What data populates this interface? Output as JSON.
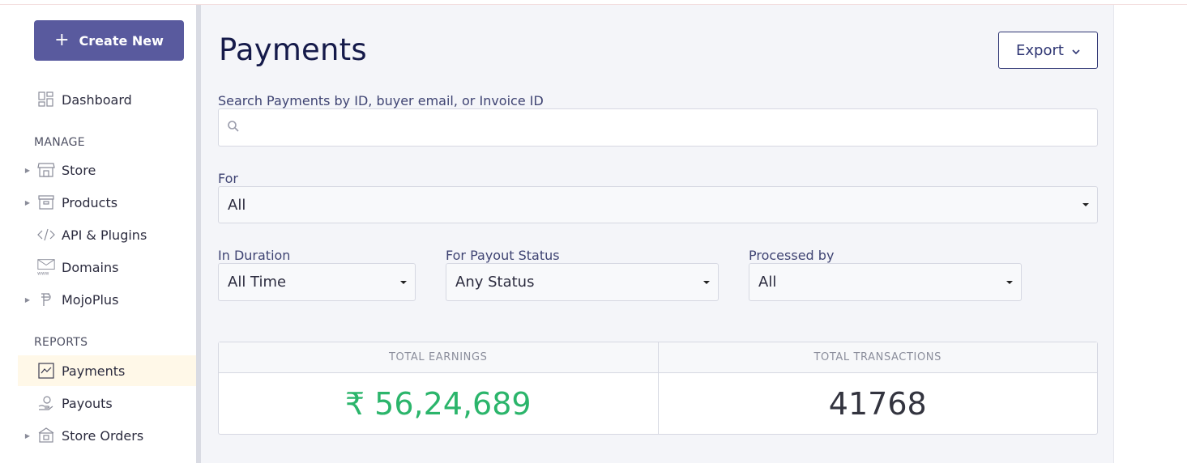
{
  "sidebar": {
    "create_label": "Create New",
    "dashboard": "Dashboard",
    "section_manage": "MANAGE",
    "manage_items": [
      {
        "label": "Store",
        "icon": "store-icon",
        "expandable": true
      },
      {
        "label": "Products",
        "icon": "products-icon",
        "expandable": true
      },
      {
        "label": "API & Plugins",
        "icon": "code-icon",
        "expandable": false
      },
      {
        "label": "Domains",
        "icon": "domains-icon",
        "expandable": false
      },
      {
        "label": "MojoPlus",
        "icon": "mojoplus-icon",
        "expandable": true
      }
    ],
    "section_reports": "REPORTS",
    "report_items": [
      {
        "label": "Payments",
        "icon": "chart-icon",
        "active": true
      },
      {
        "label": "Payouts",
        "icon": "payouts-icon"
      },
      {
        "label": "Store Orders",
        "icon": "store-orders-icon",
        "expandable": true
      }
    ]
  },
  "header": {
    "title": "Payments",
    "export_label": "Export"
  },
  "filters": {
    "search_label": "Search Payments by ID, buyer email, or Invoice ID",
    "search_value": "",
    "for_label": "For",
    "for_value": "All",
    "duration_label": "In Duration",
    "duration_value": "All Time",
    "payout_label": "For Payout Status",
    "payout_value": "Any Status",
    "processed_label": "Processed by",
    "processed_value": "All"
  },
  "stats": {
    "earnings_label": "TOTAL EARNINGS",
    "earnings_value": "₹ 56,24,689",
    "transactions_label": "TOTAL TRANSACTIONS",
    "transactions_value": "41768"
  },
  "colors": {
    "accent": "#595a9e",
    "title": "#151a4a",
    "earnings": "#2bb56b",
    "active_bg": "#fff8e8"
  }
}
